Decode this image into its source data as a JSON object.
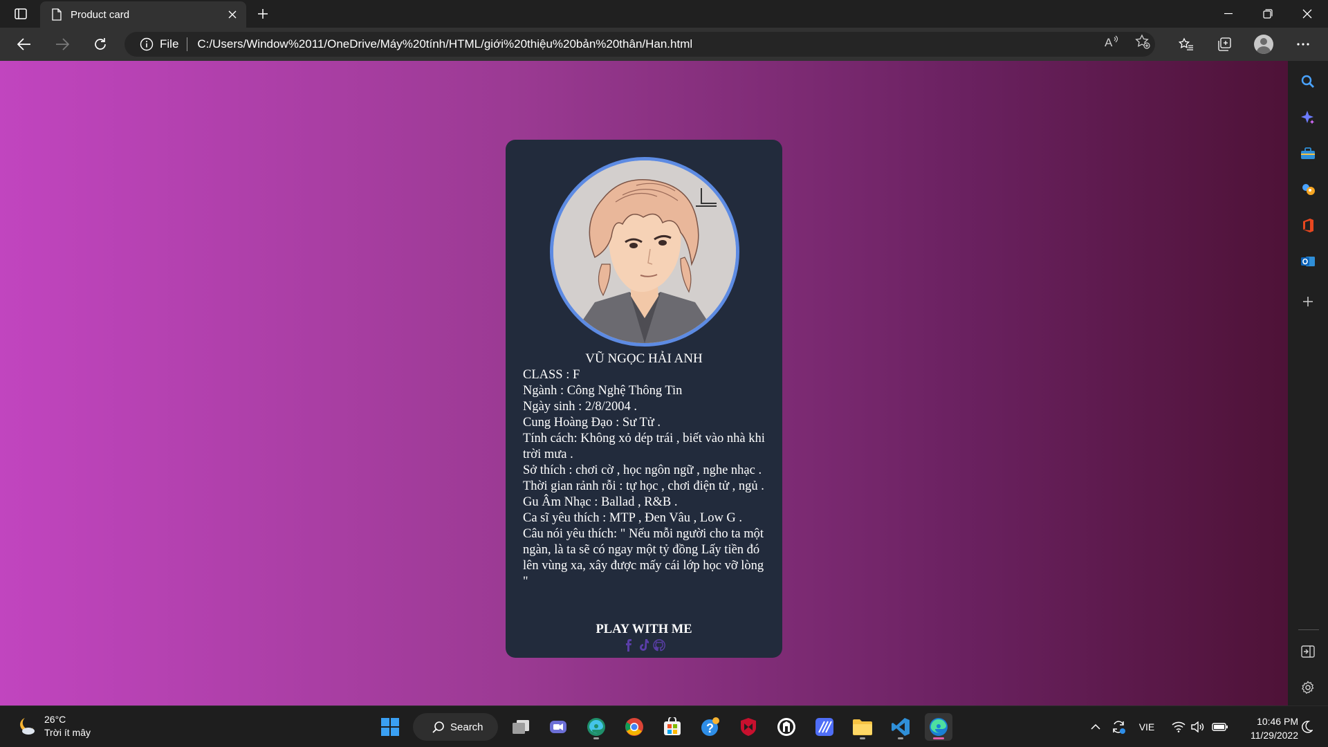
{
  "browser": {
    "tab_title": "Product card",
    "address_scheme_label": "File",
    "url": "C:/Users/Window%2011/OneDrive/Máy%20tính/HTML/giới%20thiệu%20bản%20thân/Han.html",
    "icons": [
      "tab-actions-icon",
      "page-icon",
      "close-icon",
      "plus-icon",
      "minimize-icon",
      "restore-icon",
      "close-window-icon",
      "back-icon",
      "forward-icon",
      "refresh-icon",
      "info-icon",
      "read-aloud-icon",
      "add-favorite-icon",
      "favorites-icon",
      "collections-icon",
      "profile-icon",
      "more-icon"
    ]
  },
  "card": {
    "name": "VŨ NGỌC HẢI ANH",
    "lines": [
      "CLASS : F",
      "Ngành : Công Nghệ Thông Tin",
      "Ngày sinh : 2/8/2004 .",
      "Cung Hoàng Đạo : Sư Tử .",
      "Tính cách: Không xỏ dép trái , biết vào nhà khi trời mưa .",
      "Sở thích : chơi cờ , học ngôn ngữ , nghe nhạc .",
      "Thời gian rảnh rỗi : tự học , chơi điện tử , ngủ .",
      "Gu Âm Nhạc : Ballad , R&B .",
      "Ca sĩ yêu thích : MTP , Đen Vâu , Low G .",
      "Câu nói yêu thích: \" Nếu mỗi người cho ta một ngàn, là ta sẽ có ngay một tỷ đồng Lấy tiền đó lên vùng xa, xây được mấy cái lớp học vỡ lòng \""
    ],
    "cta": "PLAY WITH ME",
    "social_icons": [
      "facebook-icon",
      "tiktok-icon",
      "github-icon"
    ],
    "accent_color": "#5d8be3",
    "card_bg": "#222b3c"
  },
  "page": {
    "gradient_from": "#c145bf",
    "gradient_to": "#4e1237"
  },
  "sidebar": {
    "icons": [
      "search-icon",
      "copilot-icon",
      "tools-icon",
      "games-icon",
      "office-icon",
      "outlook-icon",
      "add-icon",
      "hide-sidebar-icon",
      "settings-icon"
    ]
  },
  "taskbar": {
    "weather_temp": "26°C",
    "weather_desc": "Trời ít mây",
    "search_label": "Search",
    "language": "VIE",
    "time": "10:46 PM",
    "date": "11/29/2022",
    "apps": [
      "start-icon",
      "task-view-icon",
      "teams-icon",
      "edge-dev-icon",
      "chrome-icon",
      "store-icon",
      "help-icon",
      "mcafee-icon",
      "app-icon",
      "stripes-app-icon",
      "file-explorer-icon",
      "vscode-icon",
      "edge-icon"
    ]
  }
}
